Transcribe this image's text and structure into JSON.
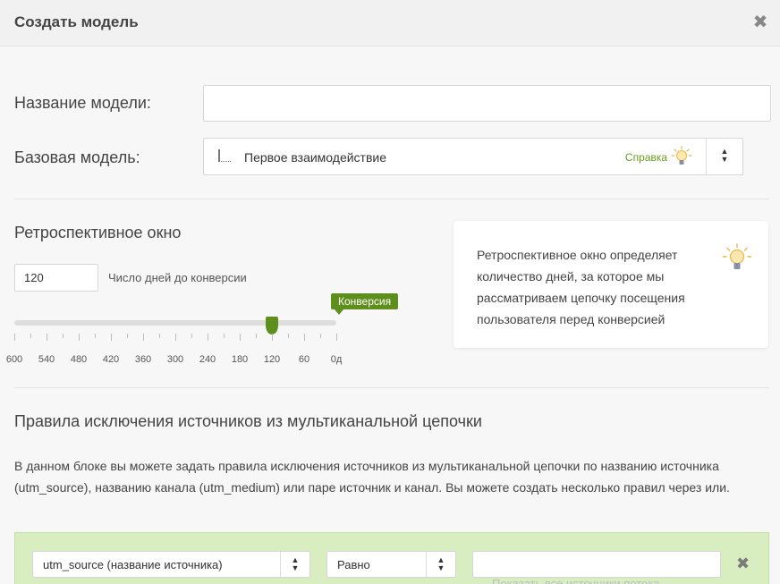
{
  "header": {
    "title": "Создать модель",
    "close_glyph": "✖"
  },
  "form": {
    "name_label": "Название модели:",
    "name_value": "",
    "base_label": "Базовая модель:",
    "base_value": "Первое взаимодействие",
    "help_label": "Справка"
  },
  "lookback": {
    "title": "Ретроспективное окно",
    "days_value": "120",
    "days_caption": "Число дней до конверсии",
    "conversion_tag": "Конверсия",
    "slider_value_days": 120,
    "slider_max_days": 600,
    "tick_labels": [
      "600",
      "540",
      "480",
      "420",
      "360",
      "300",
      "240",
      "180",
      "120",
      "60",
      "0д"
    ],
    "info_text": "Ретроспективное окно определяет количество дней, за которое мы рассматриваем цепочку посещения пользователя перед конверсией"
  },
  "exclusion": {
    "title": "Правила исключения источников из мультиканальной цепочки",
    "description": "В данном блоке вы можете задать правила исключения источников из мультиканальной цепочки по названию источника (utm_source), названию канала (utm_medium) или паре источник и канал. Вы можете создать несколько правил через или.",
    "rule": {
      "field": "utm_source (название источника)",
      "operator": "Равно",
      "value": ""
    },
    "show_all_text": "Показать все источники потока"
  },
  "colors": {
    "accent_green": "#5e8f1c",
    "help_green": "#6a9b1f",
    "rule_bg": "#d8eec0"
  },
  "icons": {
    "close": "close-icon",
    "lightbulb": "lightbulb-icon",
    "sort": "sort-arrows-icon",
    "delete": "delete-icon"
  }
}
